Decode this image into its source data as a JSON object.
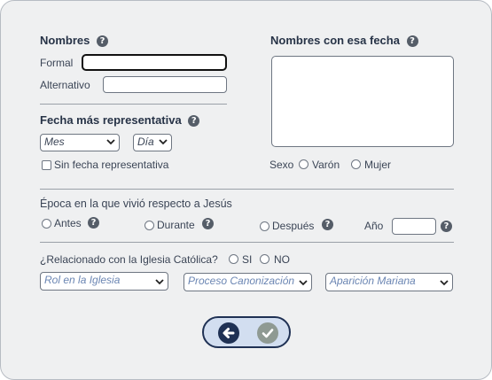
{
  "names": {
    "title": "Nombres",
    "formal_label": "Formal",
    "formal_value": "",
    "alternative_label": "Alternativo",
    "alternative_value": ""
  },
  "date_names": {
    "title": "Nombres con esa fecha",
    "sex_label": "Sexo",
    "male_label": "Varón",
    "female_label": "Mujer"
  },
  "representative_date": {
    "title": "Fecha más representativa",
    "month_selected": "Mes",
    "day_selected": "Día",
    "no_date_label": "Sin fecha representativa"
  },
  "epoch": {
    "title": "Época en la que vivió respecto a Jesús",
    "before_label": "Antes",
    "during_label": "Durante",
    "after_label": "Después",
    "year_label": "Año",
    "year_value": ""
  },
  "church": {
    "question": "¿Relacionado con la Iglesia Católica?",
    "yes_label": "SI",
    "no_label": "NO",
    "role_selected": "Rol en la Iglesia",
    "canonization_selected": "Proceso Canonización",
    "apparition_selected": "Aparición Mariana"
  },
  "help_glyph": "?",
  "icons": {
    "back": "arrow-left-icon",
    "confirm": "check-icon"
  },
  "colors": {
    "panel_bg": "#eff0f1",
    "nav_bg": "#d2def0",
    "nav_border": "#1f3154",
    "back_button": "#1f3154",
    "confirm_button": "#8f9a93"
  }
}
